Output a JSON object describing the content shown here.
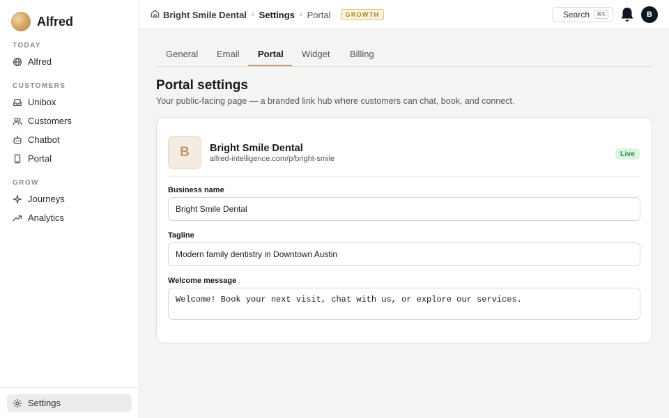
{
  "sidebar": {
    "brand": "Alfred",
    "sections": [
      {
        "label": "TODAY",
        "items": [
          {
            "label": "Alfred",
            "icon": "globe-icon"
          }
        ]
      },
      {
        "label": "CUSTOMERS",
        "items": [
          {
            "label": "Unibox",
            "icon": "inbox-icon"
          },
          {
            "label": "Customers",
            "icon": "users-icon"
          },
          {
            "label": "Chatbot",
            "icon": "bot-icon"
          },
          {
            "label": "Portal",
            "icon": "phone-icon"
          }
        ]
      },
      {
        "label": "GROW",
        "items": [
          {
            "label": "Journeys",
            "icon": "sparkle-icon"
          },
          {
            "label": "Analytics",
            "icon": "trend-icon"
          }
        ]
      }
    ],
    "settings": {
      "label": "Settings",
      "icon": "gear-icon",
      "active": true
    }
  },
  "topbar": {
    "breadcrumb": [
      "Bright Smile Dental",
      "Settings",
      "Portal"
    ],
    "plan_badge": "GROWTH",
    "search_label": "Search",
    "search_shortcut": "⌘K",
    "avatar_initial": "B"
  },
  "tabs": [
    {
      "label": "General",
      "active": false
    },
    {
      "label": "Email",
      "active": false
    },
    {
      "label": "Portal",
      "active": true
    },
    {
      "label": "Widget",
      "active": false
    },
    {
      "label": "Billing",
      "active": false
    }
  ],
  "page": {
    "title": "Portal settings",
    "subtitle": "Your public-facing page — a branded link hub where customers can chat, book, and connect."
  },
  "portal": {
    "logo_initial": "B",
    "business_name": "Bright Smile Dental",
    "url": "alfred-intelligence.com/p/bright-smile",
    "status": "Live",
    "fields": {
      "business_name_label": "Business name",
      "business_name_value": "Bright Smile Dental",
      "tagline_label": "Tagline",
      "tagline_value": "Modern family dentistry in Downtown Austin",
      "welcome_label": "Welcome message",
      "welcome_value": "Welcome! Book your next visit, chat with us, or explore our services."
    }
  },
  "colors": {
    "accent": "#c9956a",
    "live_bg": "#dcf5e2",
    "live_text": "#2f8a47",
    "plan_badge_text": "#a4822a"
  }
}
